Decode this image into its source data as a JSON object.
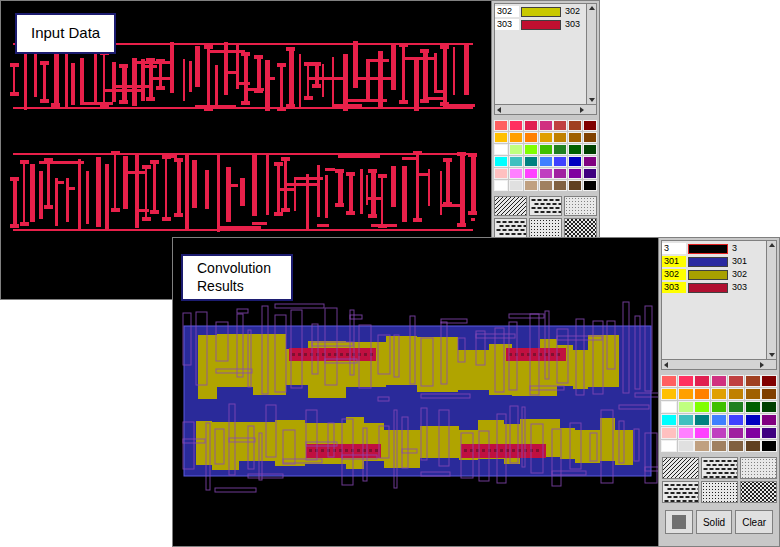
{
  "windows": [
    {
      "label": "Input Data",
      "layers": [
        {
          "left": "302",
          "right": "302",
          "color": "#c8c800",
          "kind": "solid",
          "selected": false
        },
        {
          "left": "303",
          "right": "303",
          "color": "#c01030",
          "kind": "solid",
          "selected": false
        }
      ],
      "buttons": []
    },
    {
      "label": "Convolution Results",
      "layers": [
        {
          "left": "3",
          "right": "3",
          "color": "#e02020",
          "kind": "outline",
          "selected": false
        },
        {
          "left": "301",
          "right": "301",
          "color": "#2a2aa0",
          "kind": "solid",
          "selected": true
        },
        {
          "left": "302",
          "right": "302",
          "color": "#a8a000",
          "kind": "solid",
          "selected": true
        },
        {
          "left": "303",
          "right": "303",
          "color": "#b01030",
          "kind": "solid",
          "selected": true
        }
      ],
      "buttons": [
        "Solid",
        "Clear"
      ]
    }
  ],
  "palette": [
    "#ff6060",
    "#ff3060",
    "#e02050",
    "#d03080",
    "#c04040",
    "#a04020",
    "#800000",
    "#ffc000",
    "#ffa000",
    "#ff8000",
    "#e0a000",
    "#c08000",
    "#a06000",
    "#804000",
    "#ffffff",
    "#c0ff80",
    "#80ff00",
    "#40c000",
    "#208020",
    "#006000",
    "#004000",
    "#00ffff",
    "#40c0c0",
    "#008080",
    "#4080ff",
    "#4040ff",
    "#0000c0",
    "#800080",
    "#ffc0c0",
    "#ff80ff",
    "#ff40ff",
    "#c040c0",
    "#a020a0",
    "#8000a0",
    "#400080",
    "#ffffff",
    "#e0e0e0",
    "#c0a080",
    "#a08060",
    "#806040",
    "#604020",
    "#000000"
  ]
}
